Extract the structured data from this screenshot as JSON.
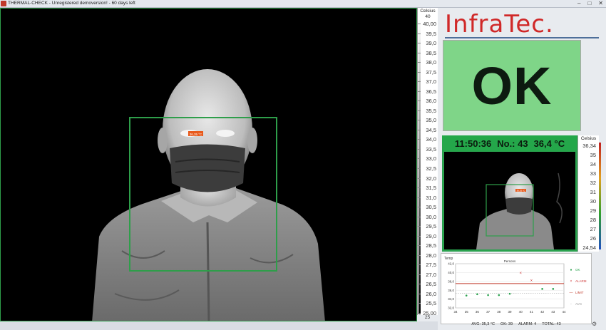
{
  "window": {
    "title": "THERMAL-CHECK - Unregistered demoversion! - 60 days left",
    "minimize": "–",
    "maximize": "□",
    "close": "✕"
  },
  "main_scale": {
    "unit": "Celsius",
    "top_value": "40",
    "bottom_value": "25",
    "ticks": [
      "40,00",
      "39,5",
      "39,0",
      "38,5",
      "38,0",
      "37,5",
      "37,0",
      "36,5",
      "36,0",
      "35,5",
      "35,0",
      "34,5",
      "34,0",
      "33,5",
      "33,0",
      "32,5",
      "32,0",
      "31,5",
      "31,0",
      "30,5",
      "30,0",
      "29,5",
      "29,0",
      "28,5",
      "28,0",
      "27,5",
      "27,0",
      "26,5",
      "26,0",
      "25,5",
      "25,00"
    ]
  },
  "main_image": {
    "measure_label": "36,35 °C"
  },
  "logo": "InfraTec.",
  "status": {
    "label": "OK",
    "color": "#7fd588"
  },
  "info_bar": {
    "time": "11:50:36",
    "number": "No.: 43",
    "temperature": "36,4 °C"
  },
  "small_image": {
    "measure_label": "36,35 °C"
  },
  "small_scale": {
    "unit": "Celsius",
    "ticks": [
      "36,34",
      "35",
      "34",
      "33",
      "32",
      "31",
      "30",
      "29",
      "28",
      "27",
      "26",
      "24,54"
    ]
  },
  "chart_data": {
    "type": "scatter",
    "title": "",
    "ylabel": "Temp",
    "xlabel": "Persons",
    "xlim": [
      34,
      44
    ],
    "ylim": [
      32.0,
      42.0
    ],
    "x_ticks": [
      "34",
      "35",
      "36",
      "37",
      "38",
      "39",
      "40",
      "41",
      "42",
      "43",
      "44"
    ],
    "y_ticks": [
      "42,0",
      "40,0",
      "38,0",
      "36,0",
      "34,0",
      "32,0"
    ],
    "limit": 37.5,
    "avg": 35.3,
    "series": [
      {
        "name": "OK",
        "color": "#2aa24e",
        "marker": "dot",
        "x": [
          35,
          36,
          37,
          38,
          39,
          42,
          43
        ],
        "y": [
          34.8,
          35.1,
          34.9,
          34.9,
          35.2,
          36.3,
          36.3
        ]
      },
      {
        "name": "ALARM",
        "color": "#d04040",
        "marker": "x",
        "x": [
          40,
          41
        ],
        "y": [
          39.9,
          38.2
        ]
      }
    ],
    "legend": [
      "OK",
      "ALARM",
      "LIMIT",
      "AVG"
    ],
    "legend_position": "right"
  },
  "stats": {
    "avg": "AVG: 35,3 °C",
    "ok": "OK: 39",
    "alarm": "ALARM: 4",
    "total": "TOTAL: 43"
  },
  "corner_value": "25"
}
